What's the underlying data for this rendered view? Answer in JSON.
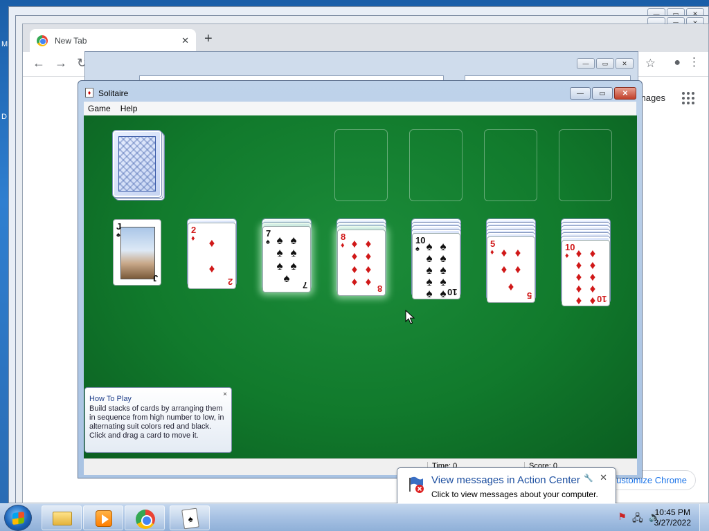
{
  "desktop": {
    "side_letters": [
      "M",
      "D"
    ]
  },
  "chrome": {
    "tab_title": "New Tab",
    "tab_close": "✕",
    "new_tab": "+",
    "images_link": "mages",
    "customize_label": "Customize Chrome"
  },
  "solitaire": {
    "title": "Solitaire",
    "menu": [
      "Game",
      "Help"
    ],
    "status": {
      "time_label": "Time: 0",
      "score_label": "Score: 0"
    },
    "tableau": [
      {
        "rank": "J",
        "suit": "♠",
        "color": "black",
        "face_down": 0
      },
      {
        "rank": "2",
        "suit": "♦",
        "color": "red",
        "face_down": 1
      },
      {
        "rank": "7",
        "suit": "♠",
        "color": "black",
        "face_down": 2
      },
      {
        "rank": "8",
        "suit": "♦",
        "color": "red",
        "face_down": 3
      },
      {
        "rank": "10",
        "suit": "♠",
        "color": "black",
        "face_down": 4
      },
      {
        "rank": "5",
        "suit": "♦",
        "color": "red",
        "face_down": 5
      },
      {
        "rank": "10",
        "suit": "♦",
        "color": "red",
        "face_down": 6
      }
    ],
    "foundations_count": 4
  },
  "howto": {
    "title": "How To Play",
    "body": "Build stacks of cards by arranging them in sequence from high number to low, in alternating suit colors red and black. Click and drag a card to move it.",
    "close": "×"
  },
  "balloon": {
    "title": "View messages in Action Center",
    "text": "Click to view messages about your computer.",
    "close": "✕"
  },
  "taskbar": {
    "time": "10:45 PM",
    "date": "3/27/2022"
  }
}
